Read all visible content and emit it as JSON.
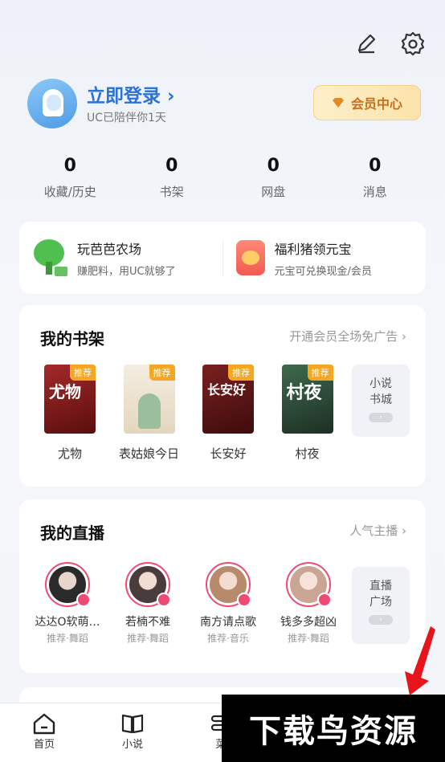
{
  "profile": {
    "login_label": "立即登录 ›",
    "subtitle": "UC已陪伴你1天",
    "vip_label": "会员中心"
  },
  "stats": [
    {
      "value": "0",
      "label": "收藏/历史"
    },
    {
      "value": "0",
      "label": "书架"
    },
    {
      "value": "0",
      "label": "网盘"
    },
    {
      "value": "0",
      "label": "消息"
    }
  ],
  "promo": {
    "farm": {
      "title": "玩芭芭农场",
      "desc": "赚肥料，用UC就够了"
    },
    "coin": {
      "title": "福利猪领元宝",
      "desc": "元宝可兑换现金/会员"
    }
  },
  "shelf": {
    "title": "我的书架",
    "more": "开通会员全场免广告 ›",
    "books": [
      {
        "name": "尤物",
        "tag": "推荐",
        "cover_text": "尤物",
        "color": "#8b1a1a"
      },
      {
        "name": "表姑娘今日",
        "tag": "推荐",
        "cover_text": "",
        "color": "#efe6d6"
      },
      {
        "name": "长安好",
        "tag": "推荐",
        "cover_text": "长安好",
        "color": "#6a1c1c"
      },
      {
        "name": "村夜",
        "tag": "推荐",
        "cover_text": "村夜",
        "color": "#2f4a3a"
      }
    ],
    "more_box": {
      "line1": "小说",
      "line2": "书城",
      "pill": "›"
    }
  },
  "live": {
    "title": "我的直播",
    "more": "人气主播 ›",
    "streamers": [
      {
        "name": "达达O软萌…",
        "sub": "推荐·舞蹈",
        "color": "#3a3a3a"
      },
      {
        "name": "若楠不难",
        "sub": "推荐·舞蹈",
        "color": "#5a4a4a"
      },
      {
        "name": "南方请点歌",
        "sub": "推荐·音乐",
        "color": "#c49a7a"
      },
      {
        "name": "钱多多超凶",
        "sub": "推荐·舞蹈",
        "color": "#d9b8a8"
      }
    ],
    "more_box": {
      "line1": "直播",
      "line2": "广场",
      "pill": "›"
    }
  },
  "tabs": [
    {
      "label": "首页"
    },
    {
      "label": "小说"
    },
    {
      "label": "菜"
    }
  ],
  "watermark": "下载鸟资源"
}
